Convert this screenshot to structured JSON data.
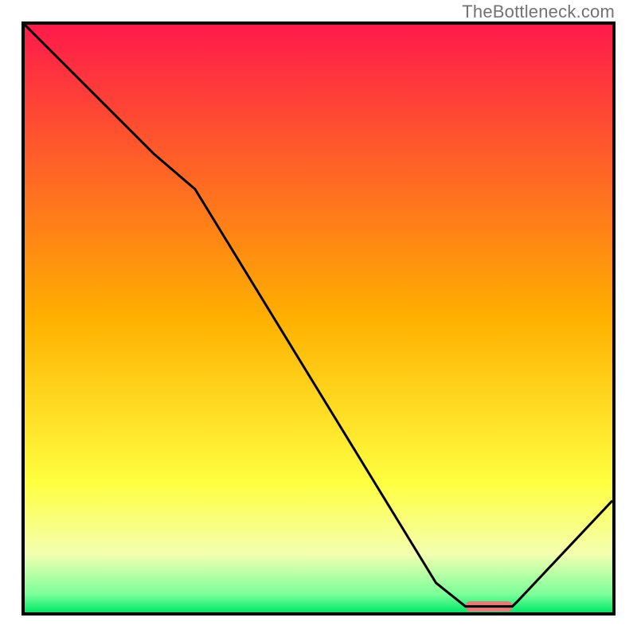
{
  "watermark": "TheBottleneck.com",
  "chart_data": {
    "type": "line",
    "title": "",
    "xlabel": "",
    "ylabel": "",
    "xlim": [
      0,
      100
    ],
    "ylim": [
      0,
      100
    ],
    "grid": false,
    "legend": false,
    "background": {
      "type": "vertical-gradient",
      "stops": [
        {
          "pos": 0.0,
          "color": "#ff1a4b"
        },
        {
          "pos": 0.5,
          "color": "#ffb000"
        },
        {
          "pos": 0.78,
          "color": "#ffff40"
        },
        {
          "pos": 0.9,
          "color": "#f4ffb0"
        },
        {
          "pos": 0.97,
          "color": "#7aff9a"
        },
        {
          "pos": 1.0,
          "color": "#00e867"
        }
      ]
    },
    "series": [
      {
        "name": "curve",
        "color": "#000000",
        "x": [
          0,
          4,
          22,
          29,
          70,
          75,
          83,
          84,
          100
        ],
        "values": [
          100,
          96,
          78,
          72,
          5,
          1,
          1,
          2,
          19
        ]
      }
    ],
    "marker": {
      "color": "#e47a7a",
      "shape": "rounded-rect",
      "x_range": [
        75,
        83
      ],
      "y": 1
    }
  }
}
